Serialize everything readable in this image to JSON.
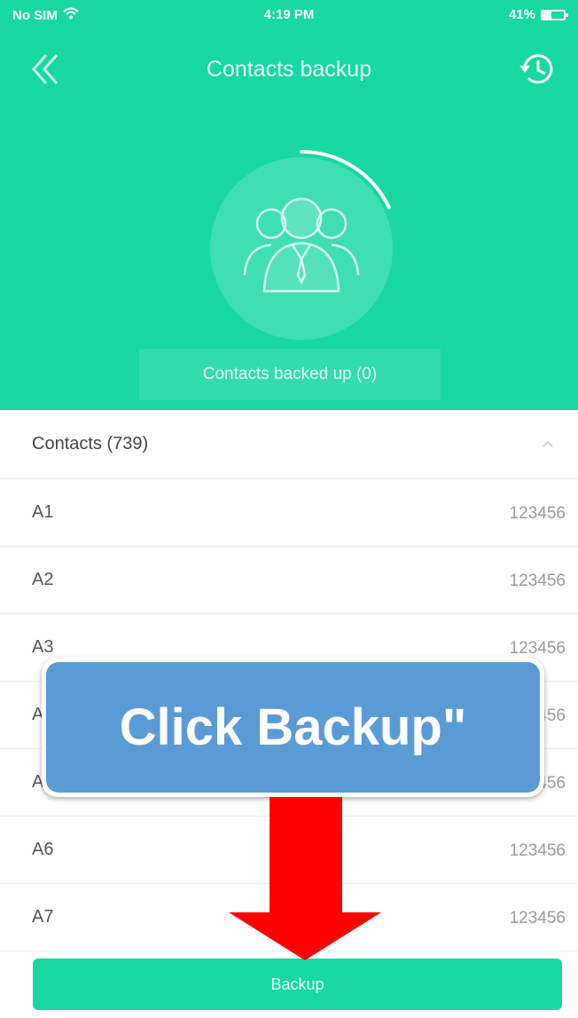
{
  "status_bar": {
    "carrier": "No SIM",
    "time": "4:19 PM",
    "battery": "41%",
    "battery_level": 0.41
  },
  "nav": {
    "title": "Contacts backup",
    "back_icon": "double-chevron-left-icon",
    "history_icon": "history-clock-icon"
  },
  "hero": {
    "icon": "contacts-group-icon",
    "progress": 0.18,
    "backed_up_label": "Contacts backed up (0)"
  },
  "contacts": {
    "header": "Contacts (739)",
    "items": [
      {
        "name": "A1",
        "number": "123456"
      },
      {
        "name": "A2",
        "number": "123456"
      },
      {
        "name": "A3",
        "number": "123456"
      },
      {
        "name": "A4",
        "number": "123456"
      },
      {
        "name": "A5",
        "number": "123456"
      },
      {
        "name": "A6",
        "number": "123456"
      },
      {
        "name": "A7",
        "number": "123456"
      }
    ]
  },
  "footer": {
    "backup_label": "Backup"
  },
  "overlay": {
    "callout_text": "Click Backup\""
  },
  "colors": {
    "primary": "#17d8a0",
    "callout_blue": "#5b9bd5",
    "arrow_red": "#ff0000"
  }
}
